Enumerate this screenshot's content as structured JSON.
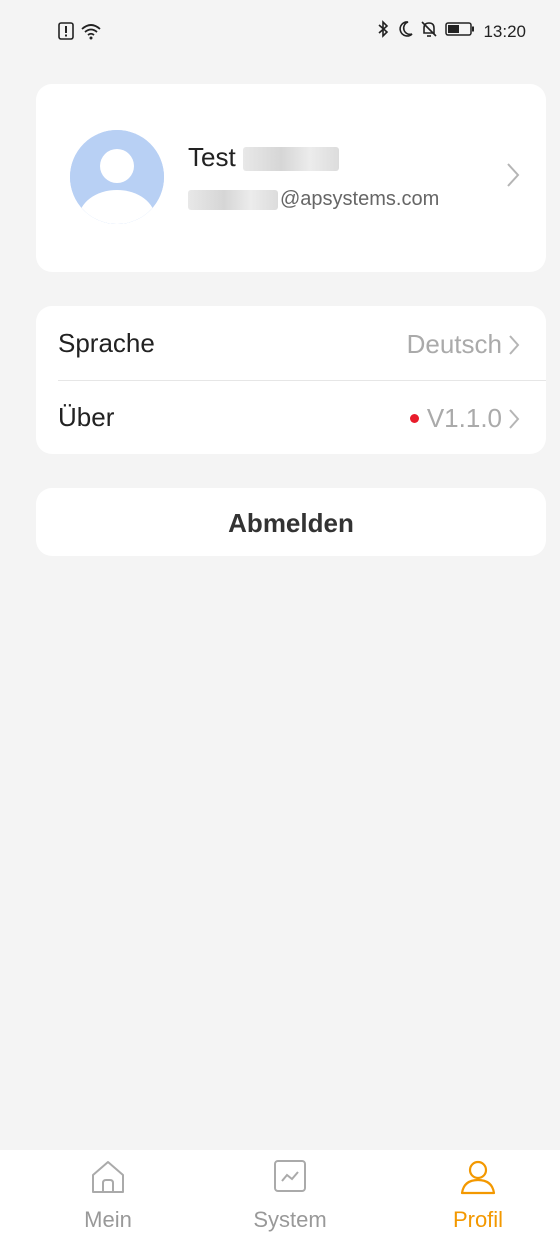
{
  "status_bar": {
    "time": "13:20",
    "left_icons": [
      "sim-alert-icon",
      "wifi-icon"
    ],
    "right_icons": [
      "bluetooth-icon",
      "moon-icon",
      "bell-off-icon",
      "battery-icon"
    ]
  },
  "profile": {
    "name": "Test",
    "email_suffix": "@apsystems.com",
    "avatar_icon": "user-avatar-icon"
  },
  "settings": {
    "language_label": "Sprache",
    "language_value": "Deutsch",
    "about_label": "Über",
    "about_value": "V1.1.0",
    "update_dot_color": "#e81c2b"
  },
  "logout": {
    "label": "Abmelden"
  },
  "tabbar": {
    "tabs": [
      {
        "label": "Mein",
        "icon": "home-icon"
      },
      {
        "label": "System",
        "icon": "chart-icon"
      },
      {
        "label": "Profil",
        "icon": "person-icon",
        "active": true
      }
    ],
    "active_color": "#f39800",
    "inactive_color": "#999999"
  }
}
